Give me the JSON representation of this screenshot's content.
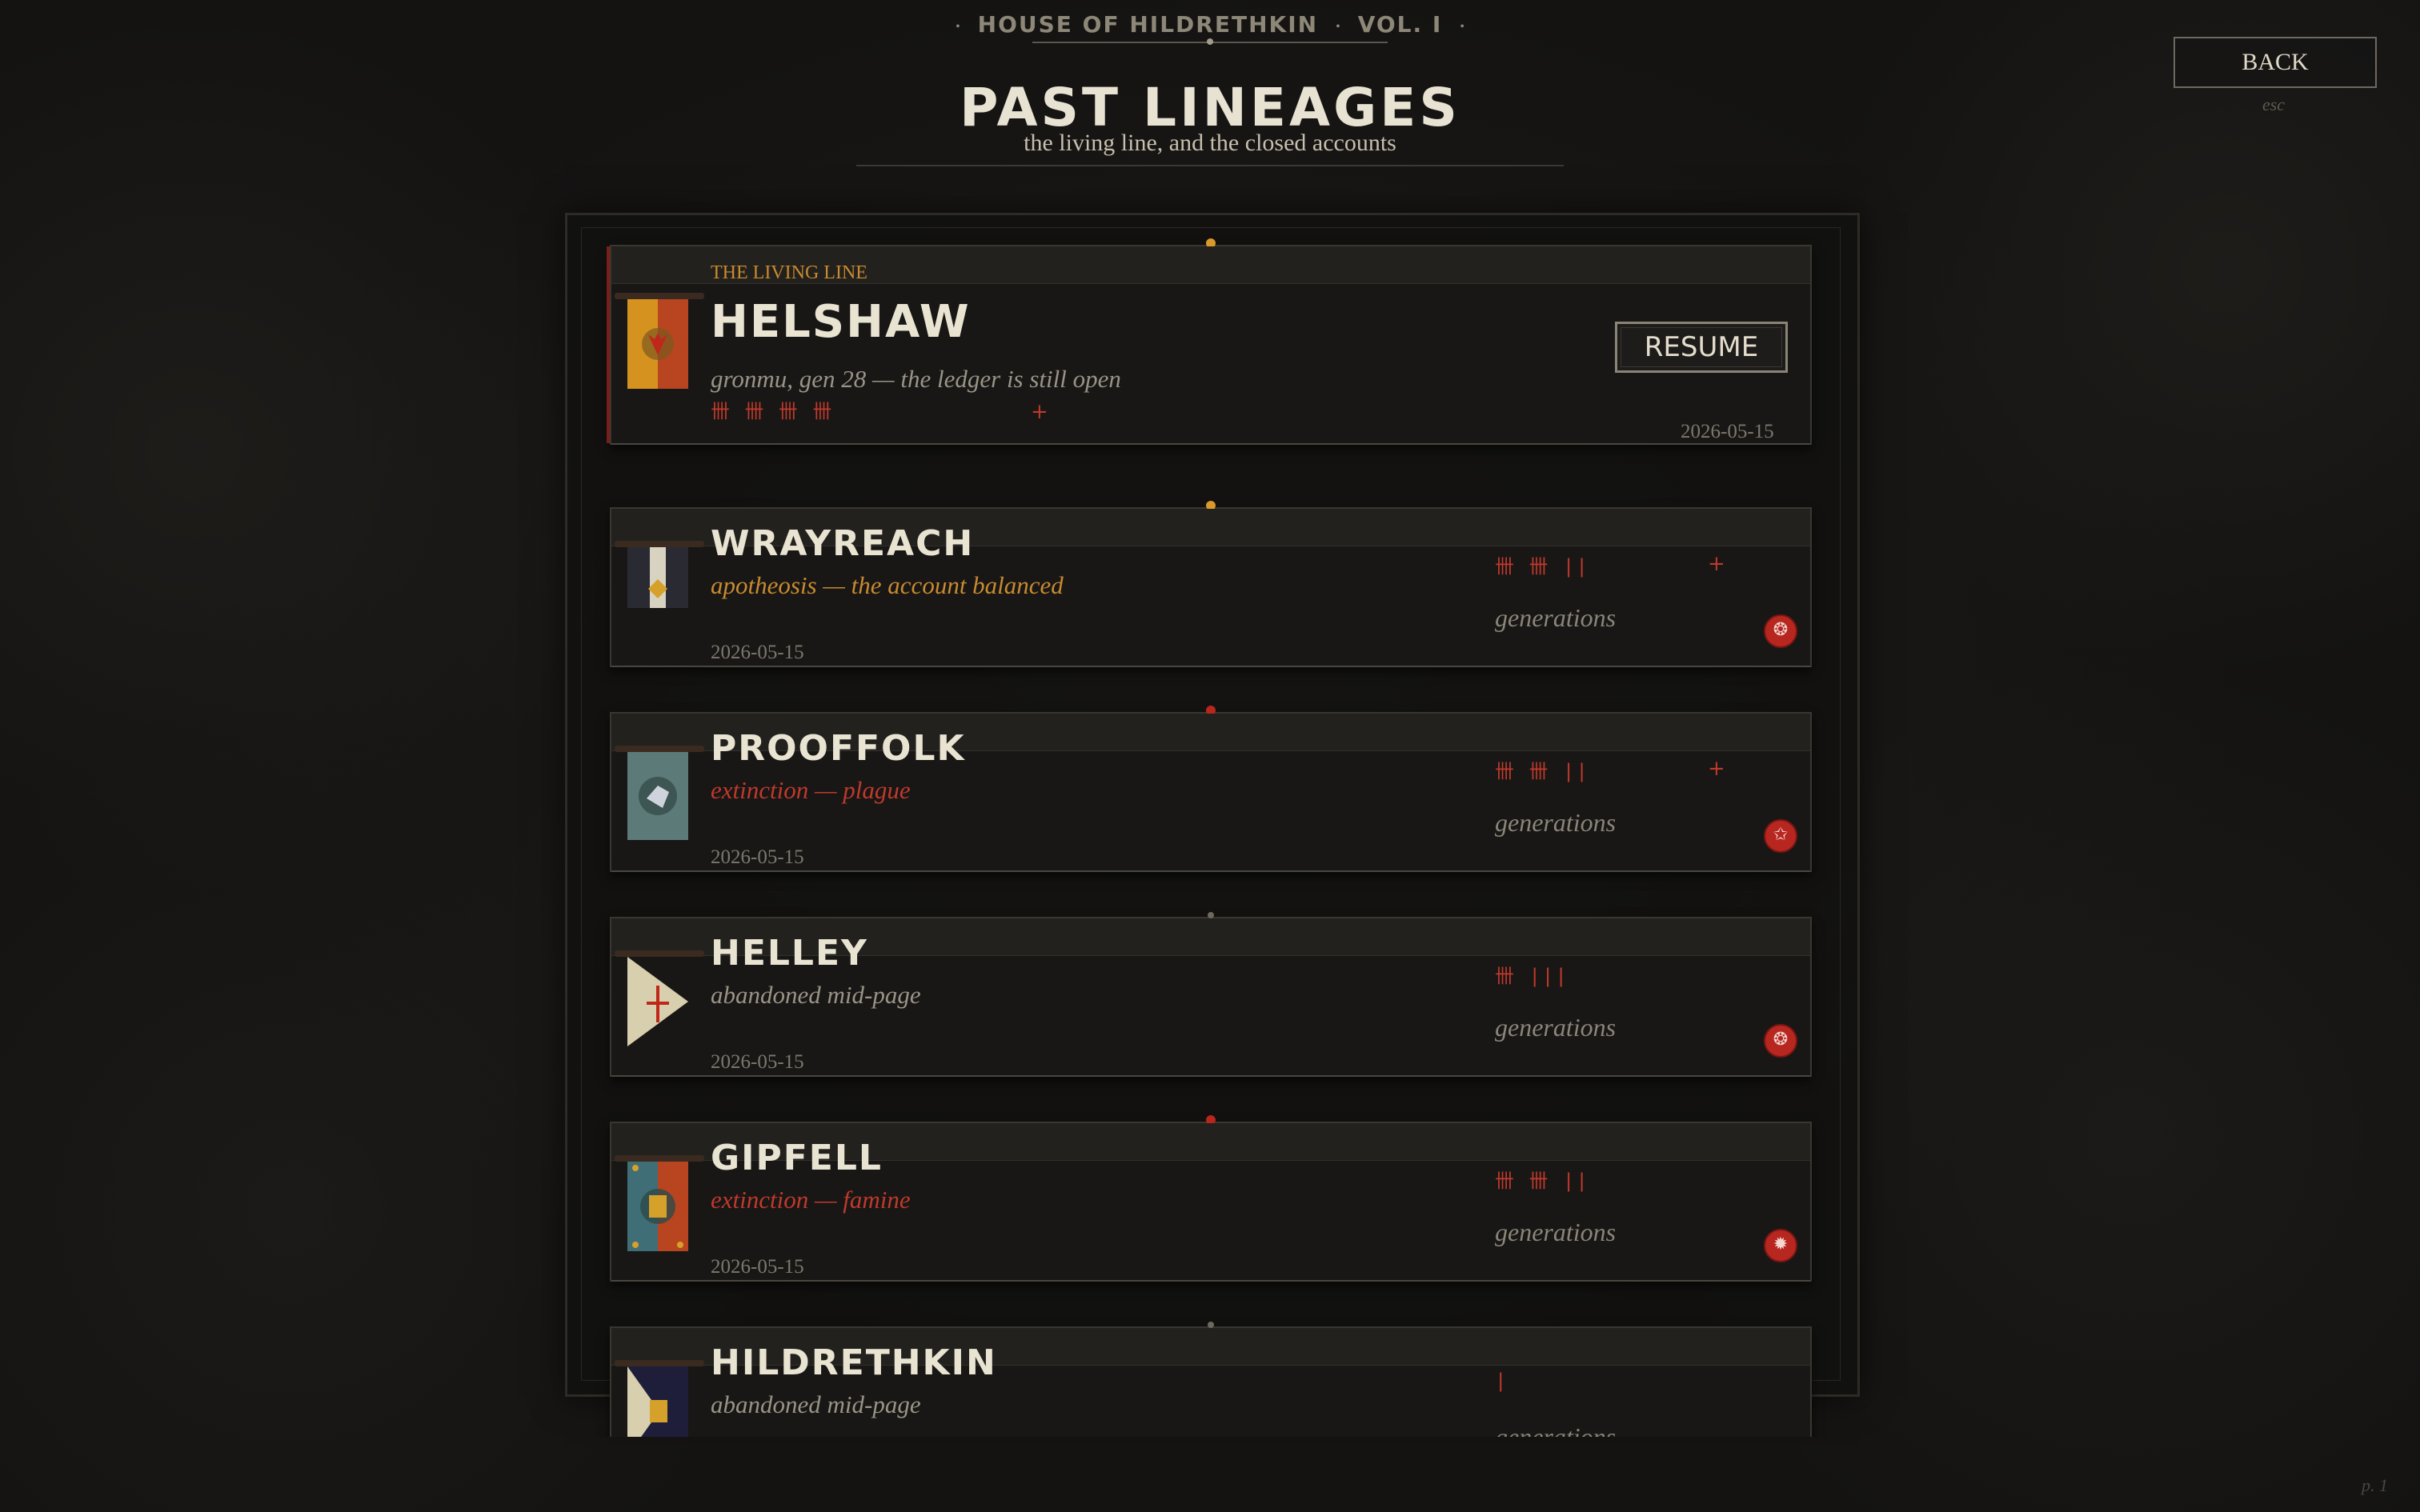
{
  "header": {
    "house": "HOUSE OF HILDRETHKIN",
    "volume": "VOL. I",
    "title": "PAST LINEAGES",
    "subtitle": "the living line, and the closed accounts"
  },
  "back": {
    "label": "BACK",
    "hint": "esc"
  },
  "page_indicator": "p. 1",
  "living": {
    "section_label": "THE LIVING LINE",
    "name": "HELSHAW",
    "status": "gronmu, gen 28 — the ledger is still open",
    "tally": "卌 卌 卌 卌",
    "plus": "+",
    "date": "2026-05-15",
    "resume_label": "RESUME"
  },
  "lineages": [
    {
      "name": "WRAYREACH",
      "outcome": "apotheosis — the account balanced",
      "date": "2026-05-15",
      "tally": "卌 卌 ||",
      "plus": "+",
      "gens_label": "generations",
      "seal": "❂",
      "outcome_color": "#c98a2f"
    },
    {
      "name": "PROOFFOLK",
      "outcome": "extinction — plague",
      "date": "2026-05-15",
      "tally": "卌 卌 ||",
      "plus": "+",
      "gens_label": "generations",
      "seal": "✩",
      "outcome_color": "#c0392b"
    },
    {
      "name": "HELLEY",
      "outcome": "abandoned mid-page",
      "date": "2026-05-15",
      "tally": "卌 |||",
      "plus": "",
      "gens_label": "generations",
      "seal": "❂",
      "outcome_color": "#9a9486"
    },
    {
      "name": "GIPFELL",
      "outcome": "extinction — famine",
      "date": "2026-05-15",
      "tally": "卌 卌 ||",
      "plus": "",
      "gens_label": "generations",
      "seal": "✹",
      "outcome_color": "#c0392b"
    },
    {
      "name": "HILDRETHKIN",
      "outcome": "abandoned mid-page",
      "date": "",
      "tally": "|",
      "plus": "",
      "gens_label": "generations",
      "seal": "",
      "outcome_color": "#9a9486"
    }
  ],
  "colors": {
    "accent_gold": "#c98a2f",
    "accent_red": "#c0392b",
    "text_light": "#e9e3d2"
  }
}
